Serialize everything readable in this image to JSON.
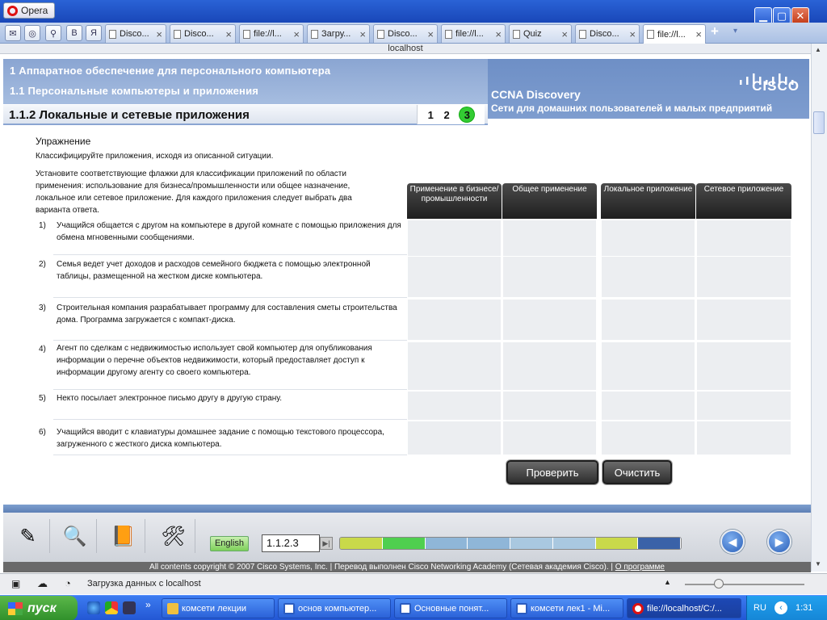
{
  "browser": {
    "menu_label": "Opera",
    "address": "localhost",
    "tabs": [
      {
        "label": "Disco..."
      },
      {
        "label": "Disco..."
      },
      {
        "label": "file://l..."
      },
      {
        "label": "Загру..."
      },
      {
        "label": "Disco..."
      },
      {
        "label": "file://l..."
      },
      {
        "label": "Quiz"
      },
      {
        "label": "Disco..."
      },
      {
        "label": "file://l..."
      }
    ],
    "quick_icons": [
      "mail-icon",
      "opera-link-icon",
      "search-widget-icon",
      "vk-icon",
      "yandex-icon"
    ],
    "quick_glyphs": [
      "✉",
      "◎",
      "⚲",
      "B",
      "Я"
    ],
    "tab_close": "×",
    "add_tab": "+",
    "tab_list": "▾",
    "window_buttons": {
      "minimize": "▁",
      "maximize": "▢",
      "close": "✕"
    },
    "status": "Загрузка данных с localhost"
  },
  "course": {
    "chapter": "1 Аппаратное обеспечение для персонального компьютера",
    "section": "1.1 Персональные компьютеры и приложения",
    "title": "1.1.2 Локальные и сетевые приложения",
    "pages": [
      "1",
      "2",
      "3"
    ],
    "current_page": "3",
    "brand_line1": "CCNA Discovery",
    "brand_line2": "Сети для домашних пользователей и малых предприятий",
    "brand_logo_text": "CISCO"
  },
  "exercise": {
    "title": "Упражнение",
    "description": "Классифицируйте приложения, исходя из описанной ситуации.",
    "instructions": "Установите соответствующие флажки для классификации приложений по области применения: использование для бизнеса/промышленности или общее назначение, локальное или сетевое приложение. Для каждого приложения следует выбрать два варианта ответа.",
    "columns": [
      "Применение в бизнесе/промышленности",
      "Общее применение",
      "Локальное приложение",
      "Сетевое приложение"
    ],
    "questions": [
      {
        "num": "1)",
        "text": "Учащийся общается с другом на компьютере в другой комнате с помощью приложения для обмена мгновенными сообщениями."
      },
      {
        "num": "2)",
        "text": "Семья ведет учет доходов и расходов семейного бюджета с помощью электронной таблицы, размещенной на жестком диске компьютера."
      },
      {
        "num": "3)",
        "text": "Строительная компания разрабатывает программу для составления сметы строительства дома.  Программа загружается с компакт-диска."
      },
      {
        "num": "4)",
        "text": "Агент по сделкам с недвижимостью использует свой компьютер для опубликования информации о перечне объектов недвижимости, который предоставляет доступ к информации другому агенту со своего компьютера."
      },
      {
        "num": "5)",
        "text": "Некто посылает электронное письмо другу в другую страну."
      },
      {
        "num": "6)",
        "text": "Учащийся вводит с клавиатуры домашнее задание с помощью текстового процессора, загруженного с жесткого диска компьютера."
      }
    ],
    "check_label": "Проверить",
    "clear_label": "Очистить"
  },
  "footer": {
    "language_label": "English",
    "section_value": "1.1.2.3",
    "tool_icons": [
      "notes-icon",
      "search-magnifier-icon",
      "book-icon",
      "tools-icon"
    ],
    "tool_glyphs": [
      "✎",
      "🔍",
      "📙",
      "🛠"
    ],
    "goto_glyph": "▶|",
    "prev_glyph": "◀",
    "next_glyph": "▶",
    "progress_colors": [
      "#c9d94a",
      "#4fcf4f",
      "#8fb6d8",
      "#8fb6d8",
      "#a9c8e0",
      "#a9c8e0",
      "#c9d94a",
      "#3a62a8"
    ],
    "copyright": "All contents copyright © 2007 Cisco Systems, Inc. | Перевод выполнен Cisco Networking Academy (Сетевая академия Cisco). | ",
    "about_link": "О программе"
  },
  "taskbar": {
    "start_label": "пуск",
    "more": "»",
    "tasks": [
      {
        "label": "комсети лекции",
        "icon": "folder-icon",
        "color": "#f0c040"
      },
      {
        "label": "основ компьютер...",
        "icon": "word-doc-icon",
        "color": "#2b5cc0"
      },
      {
        "label": "Основные понят...",
        "icon": "word-doc-icon",
        "color": "#2b5cc0"
      },
      {
        "label": "комсети лек1 - Mi...",
        "icon": "word-doc-icon",
        "color": "#2b5cc0"
      },
      {
        "label": "file://localhost/C:/...",
        "icon": "opera-icon",
        "color": "#d11"
      }
    ],
    "lang": "RU",
    "clock": "1:31"
  }
}
